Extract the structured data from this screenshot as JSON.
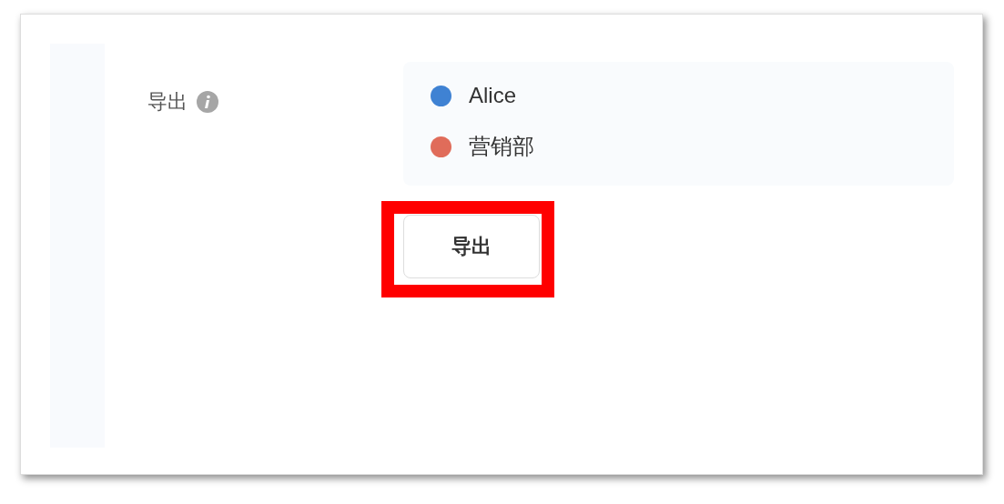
{
  "field": {
    "label": "导出",
    "info_icon": true
  },
  "recipients": [
    {
      "name": "Alice",
      "color": "#3f82d3"
    },
    {
      "name": "营销部",
      "color": "#e06c5a"
    }
  ],
  "export_button": {
    "label": "导出",
    "highlighted": true
  }
}
